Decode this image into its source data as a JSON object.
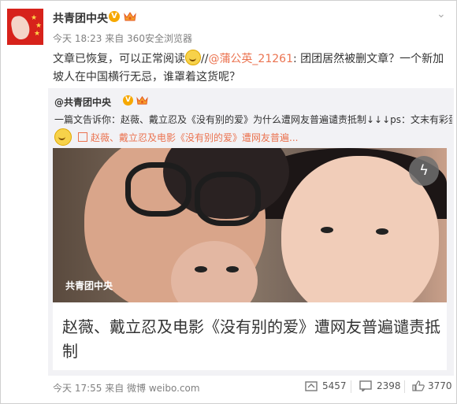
{
  "post": {
    "author": "共青团中央",
    "timestamp": "今天 18:23",
    "source": "来自 360安全浏览器",
    "text_part1": "文章已恢复，可以正常阅读",
    "text_sep": "//",
    "mention": "@蒲公英_21261",
    "text_part2": ": 团团居然被删文章？一个新加坡人在中国横行无忌，谁罩着这货呢？"
  },
  "repost": {
    "author": "@共青团中央",
    "text": "一篇文告诉你：赵薇、戴立忍及《没有别的爱》为什么遭网友普遍谴责抵制↓↓↓ps：文末有彩蛋",
    "link_text": "赵薇、戴立忍及电影《没有别的爱》遭网友普遍...",
    "card": {
      "watermark": "共青团中央",
      "title": "赵薇、戴立忍及电影《没有别的爱》遭网友普遍谴责抵制"
    },
    "footer": {
      "timestamp": "今天 17:55",
      "source": "来自 微博 weibo.com",
      "reposts": "5457",
      "comments": "2398",
      "likes": "3770"
    }
  },
  "icons": {
    "verified": "verified-badge-icon",
    "member": "crown-icon",
    "menu": "chevron-down-icon",
    "flash": "lightning-icon",
    "repost": "repost-icon",
    "comment": "comment-icon",
    "like": "thumbs-up-icon"
  },
  "colors": {
    "accent": "#eb7350",
    "verified": "#f6a800",
    "repost_bg": "#f2f2f5",
    "avatar_red": "#d7221b"
  }
}
